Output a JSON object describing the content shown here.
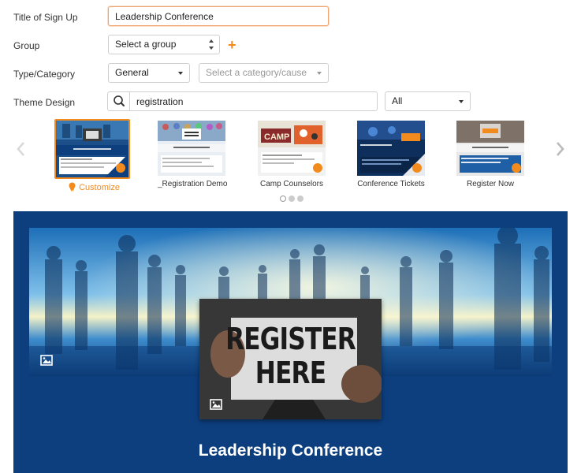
{
  "form": {
    "title_label": "Title of Sign Up",
    "title_value": "Leadership Conference",
    "group_label": "Group",
    "group_select": "Select a group",
    "type_label": "Type/Category",
    "type_select": "General",
    "category_select": "Select a category/cause",
    "theme_label": "Theme Design",
    "theme_search_value": "registration",
    "theme_filter": "All"
  },
  "carousel": {
    "customize_label": "Customize",
    "themes": [
      {
        "name": "",
        "header": "Leadership Conference",
        "subtitle": "SignUpGenius Sheet"
      },
      {
        "name": "_Registration Demo",
        "header": "REGISTER NOW",
        "subtitle": "SignUpGenius Sheet"
      },
      {
        "name": "Camp Counselors",
        "header": "CAMP",
        "subtitle": "SignUpGenius Sheet"
      },
      {
        "name": "Conference Tickets",
        "header": "BUY TICKETS",
        "subtitle": "SignUpGenius Sheet"
      },
      {
        "name": "Register Now",
        "header": "REGISTER NOW",
        "subtitle": "SignUpGenius Sheet"
      }
    ],
    "page_count": 3,
    "active_page": 1
  },
  "preview": {
    "feature_line1": "REGISTER",
    "feature_line2": "HERE",
    "title": "Leadership Conference"
  },
  "colors": {
    "accent": "#f28b1e",
    "preview_bg": "#0d3f7f",
    "focus_border": "#f2a46f"
  },
  "icons": {
    "add_group": "plus-icon",
    "search": "search-icon",
    "prev": "chevron-left-icon",
    "next": "chevron-right-icon",
    "badge": "ribbon-badge-icon",
    "image": "image-icon"
  }
}
